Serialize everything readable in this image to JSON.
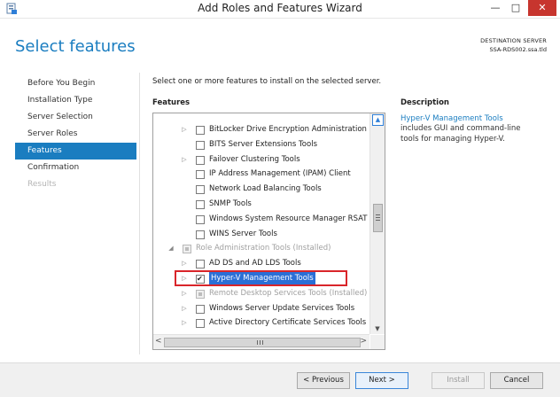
{
  "window": {
    "title": "Add Roles and Features Wizard",
    "controls": [
      "—",
      "□",
      "✕"
    ]
  },
  "header": {
    "page_title": "Select features",
    "destination_label": "DESTINATION SERVER",
    "destination_server": "SSA-RDS002.ssa.tld"
  },
  "nav": {
    "items": [
      {
        "label": "Before You Begin",
        "state": "normal"
      },
      {
        "label": "Installation Type",
        "state": "normal"
      },
      {
        "label": "Server Selection",
        "state": "normal"
      },
      {
        "label": "Server Roles",
        "state": "normal"
      },
      {
        "label": "Features",
        "state": "active"
      },
      {
        "label": "Confirmation",
        "state": "normal"
      },
      {
        "label": "Results",
        "state": "disabled"
      }
    ]
  },
  "content": {
    "instruction": "Select one or more features to install on the selected server.",
    "features_label": "Features",
    "description_label": "Description",
    "description_link": "Hyper-V Management Tools",
    "description_rest": "includes GUI and command-line tools for managing Hyper-V."
  },
  "features": [
    {
      "label": "BitLocker Drive Encryption Administration Utilities",
      "expander": "collapsed",
      "checkbox": "unchecked",
      "level": 1
    },
    {
      "label": "BITS Server Extensions Tools",
      "expander": "none",
      "checkbox": "unchecked",
      "level": 1
    },
    {
      "label": "Failover Clustering Tools",
      "expander": "collapsed",
      "checkbox": "unchecked",
      "level": 1
    },
    {
      "label": "IP Address Management (IPAM) Client",
      "expander": "none",
      "checkbox": "unchecked",
      "level": 1
    },
    {
      "label": "Network Load Balancing Tools",
      "expander": "none",
      "checkbox": "unchecked",
      "level": 1
    },
    {
      "label": "SNMP Tools",
      "expander": "none",
      "checkbox": "unchecked",
      "level": 1
    },
    {
      "label": "Windows System Resource Manager RSAT",
      "expander": "none",
      "checkbox": "unchecked",
      "level": 1
    },
    {
      "label": "WINS Server Tools",
      "expander": "none",
      "checkbox": "unchecked",
      "level": 1
    },
    {
      "label": "Role Administration Tools (Installed)",
      "expander": "expanded",
      "checkbox": "partial-disabled",
      "level": 0
    },
    {
      "label": "AD DS and AD LDS Tools",
      "expander": "collapsed",
      "checkbox": "unchecked",
      "level": 1
    },
    {
      "label": "Hyper-V Management Tools",
      "expander": "collapsed",
      "checkbox": "checked",
      "level": 1,
      "selected": true
    },
    {
      "label": "Remote Desktop Services Tools (Installed)",
      "expander": "collapsed",
      "checkbox": "partial-disabled",
      "level": 1
    },
    {
      "label": "Windows Server Update Services Tools",
      "expander": "collapsed",
      "checkbox": "unchecked",
      "level": 1
    },
    {
      "label": "Active Directory Certificate Services Tools",
      "expander": "collapsed",
      "checkbox": "unchecked",
      "level": 1
    }
  ],
  "scrollbar": {
    "up": "▲",
    "down": "▼",
    "left": "<",
    "right": ">"
  },
  "buttons": {
    "previous": "< Previous",
    "next": "Next >",
    "install": "Install",
    "cancel": "Cancel"
  },
  "colors": {
    "accent": "#1a7dc0",
    "close_button": "#c7352e",
    "selection": "#2b6fd6",
    "highlight_box": "#d9252a"
  }
}
